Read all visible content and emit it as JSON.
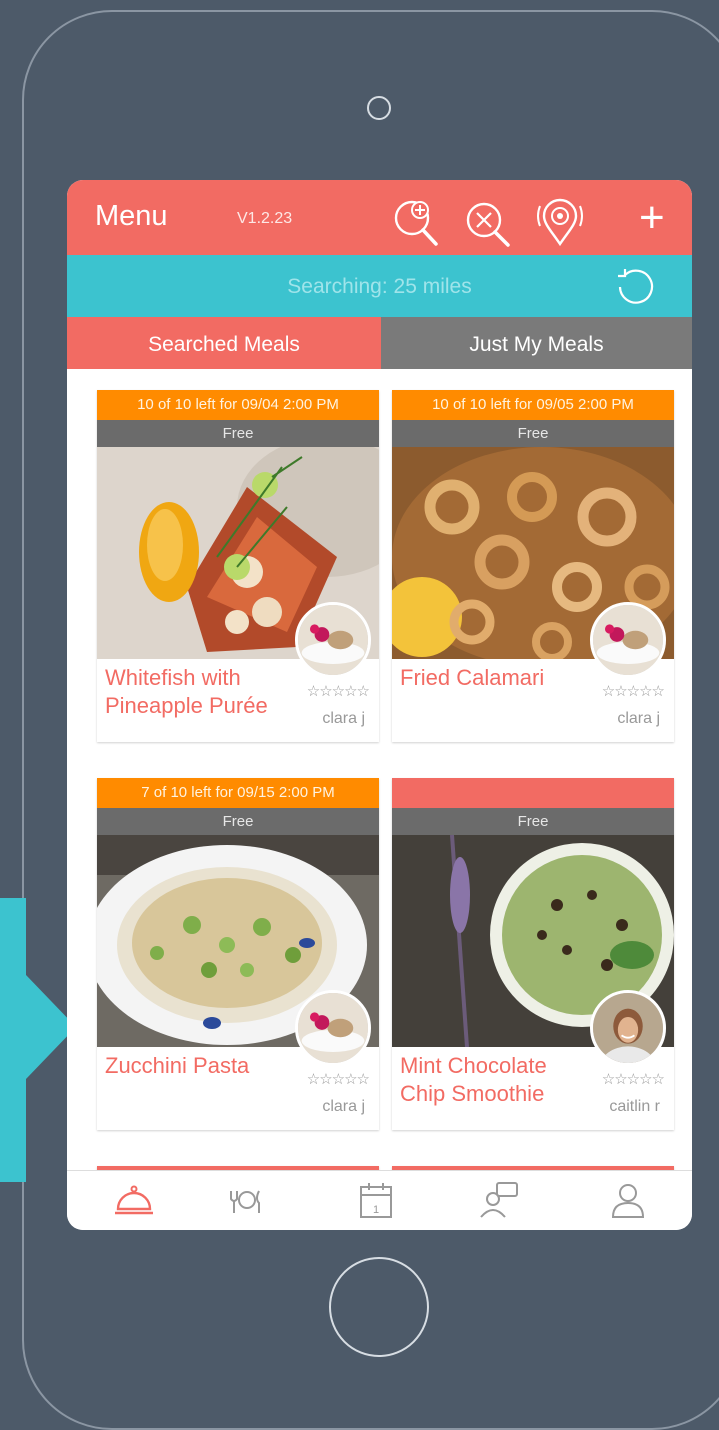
{
  "header": {
    "title": "Menu",
    "version": "V1.2.23"
  },
  "search": {
    "status": "Searching: 25 miles"
  },
  "tabs": [
    {
      "label": "Searched Meals"
    },
    {
      "label": "Just My Meals"
    }
  ],
  "meals": [
    {
      "availability": "10 of 10 left for 09/04 2:00 PM",
      "price": "Free",
      "title": "Whitefish with Pineapple Purée",
      "rating": "☆☆☆☆☆",
      "chef": "clara j"
    },
    {
      "availability": "10 of 10 left for 09/05 2:00 PM",
      "price": "Free",
      "title": "Fried Calamari",
      "rating": "☆☆☆☆☆",
      "chef": "clara j"
    },
    {
      "availability": "7 of 10 left for 09/15 2:00 PM",
      "price": "Free",
      "title": "Zucchini Pasta",
      "rating": "☆☆☆☆☆",
      "chef": "clara j"
    },
    {
      "availability": "",
      "price": "Free",
      "title": "Mint Chocolate Chip Smoothie",
      "rating": "☆☆☆☆☆",
      "chef": "caitlin r"
    }
  ],
  "colors": {
    "brand": "#f26b63",
    "accent": "#3cc3cf",
    "availability": "#ff8b00",
    "background": "#4d5a69"
  },
  "icons": {
    "header": [
      "search-add-icon",
      "search-clear-icon",
      "location-icon",
      "plus-icon"
    ],
    "nav": [
      "cloche-icon",
      "utensils-icon",
      "calendar-icon",
      "chat-icon",
      "profile-icon"
    ]
  }
}
